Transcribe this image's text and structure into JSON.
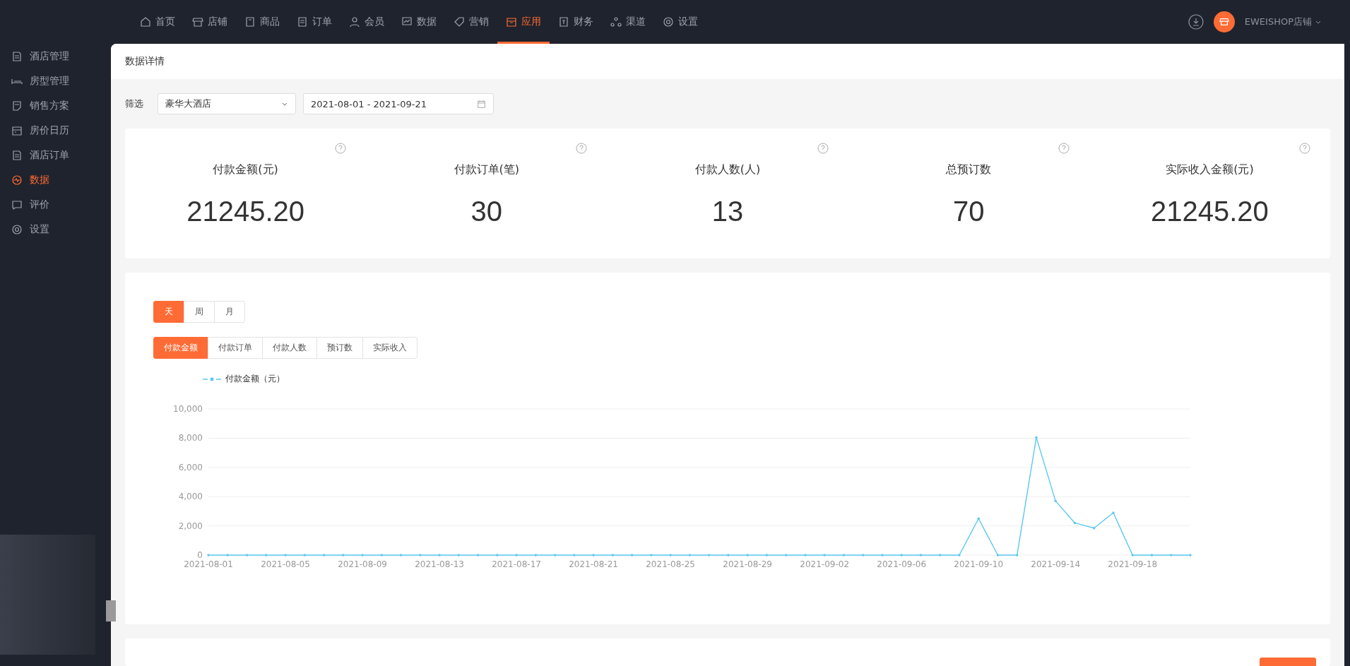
{
  "top_nav": [
    {
      "label": "首页",
      "selected": false
    },
    {
      "label": "店铺",
      "selected": false
    },
    {
      "label": "商品",
      "selected": false
    },
    {
      "label": "订单",
      "selected": false
    },
    {
      "label": "会员",
      "selected": false
    },
    {
      "label": "数据",
      "selected": false
    },
    {
      "label": "营销",
      "selected": false
    },
    {
      "label": "应用",
      "selected": true
    },
    {
      "label": "财务",
      "selected": false
    },
    {
      "label": "渠道",
      "selected": false
    },
    {
      "label": "设置",
      "selected": false
    }
  ],
  "account": {
    "name": "EWEISHOP店铺"
  },
  "sidebar": {
    "items": [
      {
        "label": "酒店管理",
        "selected": false
      },
      {
        "label": "房型管理",
        "selected": false
      },
      {
        "label": "销售方案",
        "selected": false
      },
      {
        "label": "房价日历",
        "selected": false
      },
      {
        "label": "酒店订单",
        "selected": false
      },
      {
        "label": "数据",
        "selected": true
      },
      {
        "label": "评价",
        "selected": false
      },
      {
        "label": "设置",
        "selected": false
      }
    ]
  },
  "page_title": "数据详情",
  "filter": {
    "label": "筛选",
    "hotel": "豪华大酒店",
    "date_range": "2021-08-01 - 2021-09-21"
  },
  "stats": [
    {
      "label": "付款金额(元)",
      "value": "21245.20"
    },
    {
      "label": "付款订单(笔)",
      "value": "30"
    },
    {
      "label": "付款人数(人)",
      "value": "13"
    },
    {
      "label": "总预订数",
      "value": "70"
    },
    {
      "label": "实际收入金额(元)",
      "value": "21245.20"
    }
  ],
  "period_tabs": [
    {
      "label": "天",
      "selected": true
    },
    {
      "label": "周",
      "selected": false
    },
    {
      "label": "月",
      "selected": false
    }
  ],
  "metric_tabs": [
    {
      "label": "付款金额",
      "selected": true
    },
    {
      "label": "付款订单",
      "selected": false
    },
    {
      "label": "付款人数",
      "selected": false
    },
    {
      "label": "预订数",
      "selected": false
    },
    {
      "label": "实际收入",
      "selected": false
    }
  ],
  "chart_data": {
    "type": "line",
    "x": [
      "2021-08-01",
      "2021-08-02",
      "2021-08-03",
      "2021-08-04",
      "2021-08-05",
      "2021-08-06",
      "2021-08-07",
      "2021-08-08",
      "2021-08-09",
      "2021-08-10",
      "2021-08-11",
      "2021-08-12",
      "2021-08-13",
      "2021-08-14",
      "2021-08-15",
      "2021-08-16",
      "2021-08-17",
      "2021-08-18",
      "2021-08-19",
      "2021-08-20",
      "2021-08-21",
      "2021-08-22",
      "2021-08-23",
      "2021-08-24",
      "2021-08-25",
      "2021-08-26",
      "2021-08-27",
      "2021-08-28",
      "2021-08-29",
      "2021-08-30",
      "2021-08-31",
      "2021-09-01",
      "2021-09-02",
      "2021-09-03",
      "2021-09-04",
      "2021-09-05",
      "2021-09-06",
      "2021-09-07",
      "2021-09-08",
      "2021-09-09",
      "2021-09-10",
      "2021-09-11",
      "2021-09-12",
      "2021-09-13",
      "2021-09-14",
      "2021-09-15",
      "2021-09-16",
      "2021-09-17",
      "2021-09-18",
      "2021-09-19",
      "2021-09-20",
      "2021-09-21"
    ],
    "series": [
      {
        "name": "付款金额（元）",
        "color": "#5bc8ef",
        "values": [
          0,
          0,
          0,
          0,
          0,
          0,
          0,
          0,
          0,
          0,
          0,
          0,
          0,
          0,
          0,
          0,
          0,
          0,
          0,
          0,
          0,
          0,
          0,
          0,
          0,
          0,
          0,
          0,
          0,
          0,
          0,
          0,
          0,
          0,
          0,
          0,
          0,
          0,
          0,
          0,
          2500,
          0,
          0,
          8050,
          3700,
          2200,
          1850,
          2900,
          0,
          0,
          0,
          0
        ]
      }
    ],
    "xlim": [
      "2021-08-01",
      "2021-09-21"
    ],
    "grid": true,
    "ylim": [
      0,
      10000
    ],
    "yticks": [
      {
        "value": 0,
        "label": "0"
      },
      {
        "value": 2000,
        "label": "2,000"
      },
      {
        "value": 4000,
        "label": "4,000"
      },
      {
        "value": 6000,
        "label": "6,000"
      },
      {
        "value": 8000,
        "label": "8,000"
      },
      {
        "value": 10000,
        "label": "10,000"
      }
    ],
    "xticks": [
      "2021-08-01",
      "2021-08-05",
      "2021-08-09",
      "2021-08-13",
      "2021-08-17",
      "2021-08-21",
      "2021-08-25",
      "2021-08-29",
      "2021-09-02",
      "2021-09-06",
      "2021-09-10",
      "2021-09-14",
      "2021-09-18"
    ]
  }
}
